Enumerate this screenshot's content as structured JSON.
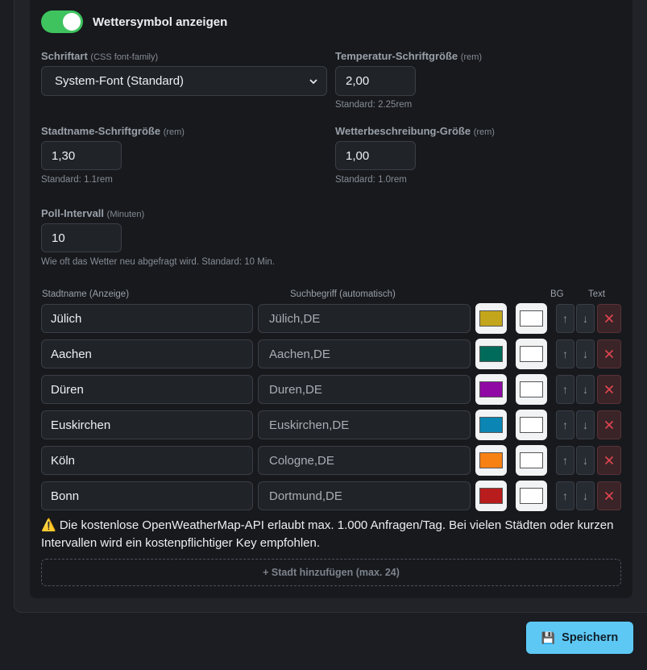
{
  "toggle": {
    "label": "Wettersymbol anzeigen",
    "on": true
  },
  "font": {
    "label": "Schriftart",
    "hint": "(CSS font-family)",
    "value": "System-Font (Standard)"
  },
  "temp_size": {
    "label": "Temperatur-Schriftgröße",
    "hint": "(rem)",
    "value": "2,00",
    "help": "Standard: 2.25rem"
  },
  "city_size": {
    "label": "Stadtname-Schriftgröße",
    "hint": "(rem)",
    "value": "1,30",
    "help": "Standard: 1.1rem"
  },
  "desc_size": {
    "label": "Wetterbeschreibung-Größe",
    "hint": "(rem)",
    "value": "1,00",
    "help": "Standard: 1.0rem"
  },
  "poll": {
    "label": "Poll-Intervall",
    "hint": "(Minuten)",
    "value": "10",
    "help": "Wie oft das Wetter neu abgefragt wird. Standard: 10 Min."
  },
  "columns": {
    "name": "Stadtname (Anzeige)",
    "query": "Suchbegriff (automatisch)",
    "bg": "BG",
    "text": "Text"
  },
  "cities": [
    {
      "name": "Jülich",
      "query": "Jülich,DE",
      "bg": "#c3a61b",
      "text": "#ffffff"
    },
    {
      "name": "Aachen",
      "query": "Aachen,DE",
      "bg": "#006b5a",
      "text": "#ffffff"
    },
    {
      "name": "Düren",
      "query": "Duren,DE",
      "bg": "#9009a5",
      "text": "#ffffff"
    },
    {
      "name": "Euskirchen",
      "query": "Euskirchen,DE",
      "bg": "#0a85b4",
      "text": "#ffffff"
    },
    {
      "name": "Köln",
      "query": "Cologne,DE",
      "bg": "#f78113",
      "text": "#ffffff"
    },
    {
      "name": "Bonn",
      "query": "Dortmund,DE",
      "bg": "#b81c1c",
      "text": "#ffffff"
    }
  ],
  "warning": "⚠️ Die kostenlose OpenWeatherMap-API erlaubt max. 1.000 Anfragen/Tag. Bei vielen Städten oder kurzen Intervallen wird ein kostenpflichtiger Key empfohlen.",
  "add_button": "+ Stadt hinzufügen (max. 24)",
  "save_button": "Speichern",
  "icons": {
    "up": "↑",
    "down": "↓",
    "remove": "close-icon",
    "save": "💾"
  },
  "colors": {
    "accent": "#5ec8f5",
    "toggle_on": "#3fc35f",
    "danger": "#e0454f"
  }
}
